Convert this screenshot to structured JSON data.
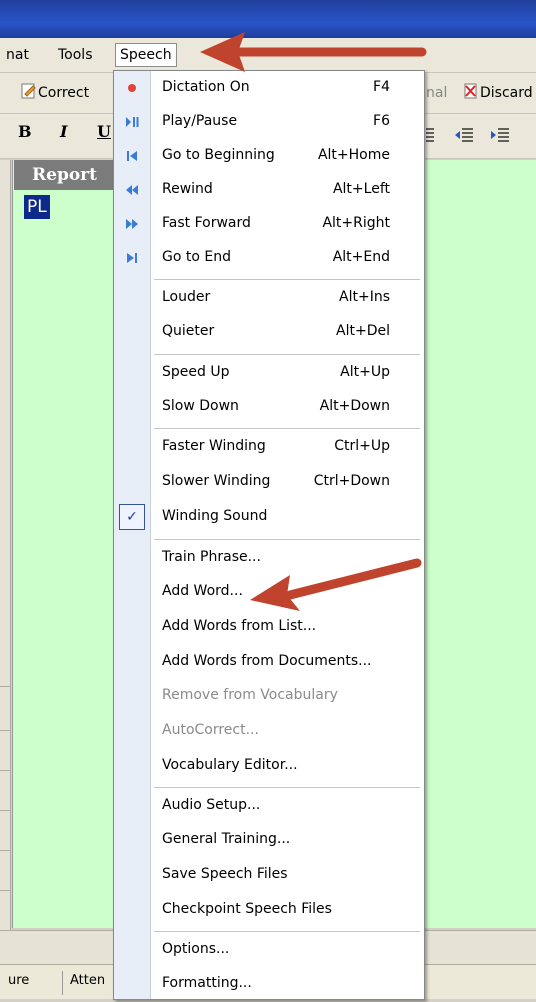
{
  "menubar": {
    "items": [
      {
        "label": "nat"
      },
      {
        "label": "Tools"
      },
      {
        "label": "Speech"
      }
    ]
  },
  "toolbar": {
    "correct_label": "Correct",
    "nal_label": "nal",
    "discard_label": "Discard"
  },
  "format": {
    "bold": "B",
    "italic": "I",
    "underline": "U"
  },
  "report": {
    "heading": "Report",
    "selected_text": "PL"
  },
  "status": {
    "cell1": "ure",
    "cell2": "Atten"
  },
  "speech_menu": {
    "items": [
      {
        "label": "Dictation On",
        "shortcut": "F4",
        "icon": "record-icon"
      },
      {
        "label": "Play/Pause",
        "shortcut": "F6",
        "icon": "play-pause-icon"
      },
      {
        "label": "Go to Beginning",
        "shortcut": "Alt+Home",
        "icon": "go-beginning-icon"
      },
      {
        "label": "Rewind",
        "shortcut": "Alt+Left",
        "icon": "rewind-icon"
      },
      {
        "label": "Fast Forward",
        "shortcut": "Alt+Right",
        "icon": "fast-forward-icon"
      },
      {
        "label": "Go to End",
        "shortcut": "Alt+End",
        "icon": "go-end-icon"
      },
      {
        "label": "Louder",
        "shortcut": "Alt+Ins"
      },
      {
        "label": "Quieter",
        "shortcut": "Alt+Del"
      },
      {
        "label": "Speed Up",
        "shortcut": "Alt+Up"
      },
      {
        "label": "Slow Down",
        "shortcut": "Alt+Down"
      },
      {
        "label": "Faster Winding",
        "shortcut": "Ctrl+Up"
      },
      {
        "label": "Slower Winding",
        "shortcut": "Ctrl+Down"
      },
      {
        "label": "Winding Sound",
        "shortcut": "",
        "checked": true
      },
      {
        "label": "Train Phrase...",
        "shortcut": ""
      },
      {
        "label": "Add Word...",
        "shortcut": ""
      },
      {
        "label": "Add Words from List...",
        "shortcut": ""
      },
      {
        "label": "Add Words from Documents...",
        "shortcut": ""
      },
      {
        "label": "Remove from Vocabulary",
        "shortcut": "",
        "disabled": true
      },
      {
        "label": "AutoCorrect...",
        "shortcut": "",
        "disabled": true
      },
      {
        "label": "Vocabulary Editor...",
        "shortcut": ""
      },
      {
        "label": "Audio Setup...",
        "shortcut": ""
      },
      {
        "label": "General Training...",
        "shortcut": ""
      },
      {
        "label": "Save Speech Files",
        "shortcut": ""
      },
      {
        "label": "Checkpoint Speech Files",
        "shortcut": ""
      },
      {
        "label": "Options...",
        "shortcut": ""
      },
      {
        "label": "Formatting...",
        "shortcut": ""
      }
    ]
  },
  "colors": {
    "arrow": "#c0432e",
    "report_bg": "#ccffcc",
    "titlebar": "#2a55c9"
  }
}
